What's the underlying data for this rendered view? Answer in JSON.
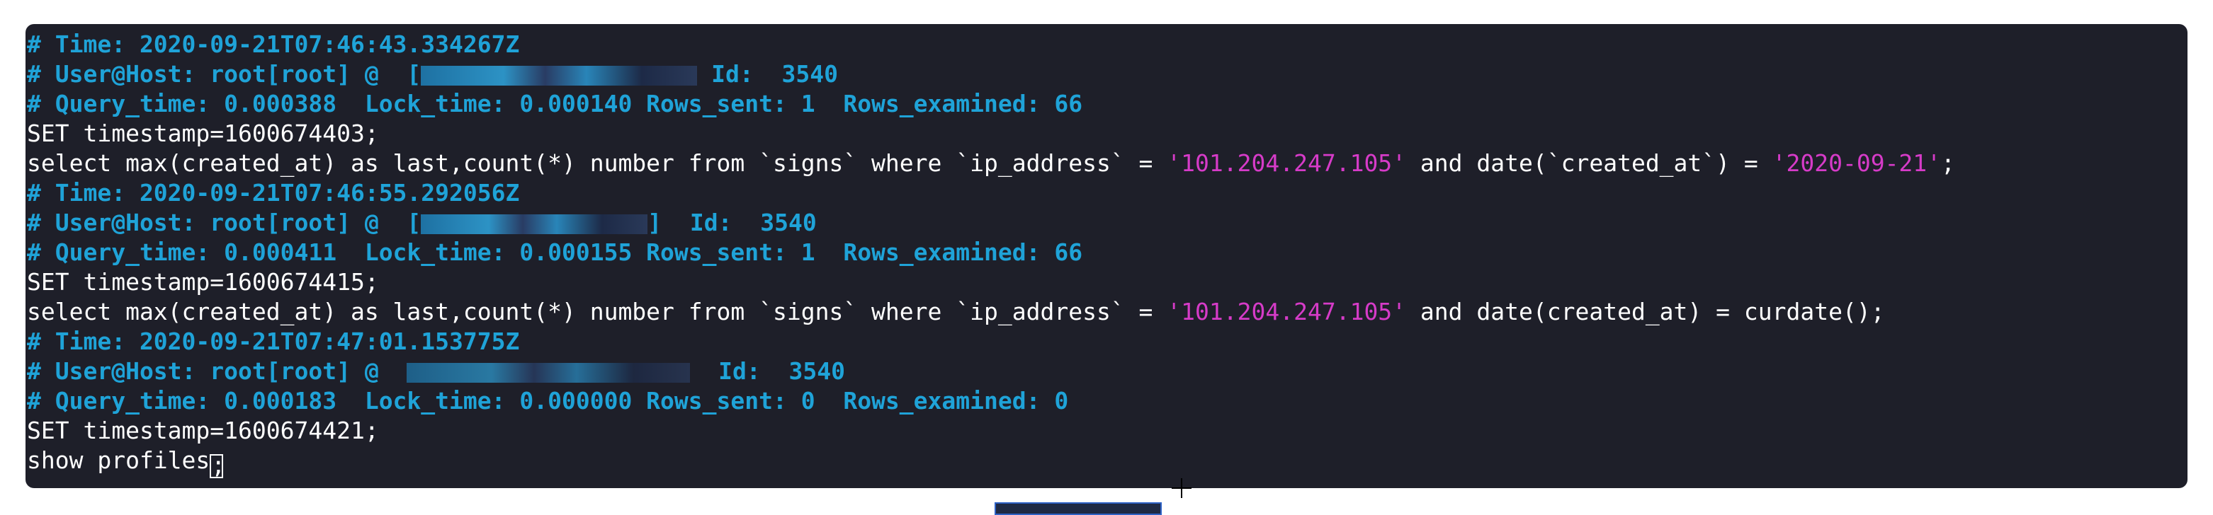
{
  "terminal": {
    "lines": [
      {
        "type": "comment",
        "text": "# Time: 2020-09-21T07:46:43.334267Z"
      },
      {
        "type": "userhost",
        "prefix": "# User@Host: root[root] @  [",
        "suffix": " Id:  3540"
      },
      {
        "type": "comment",
        "text": "# Query_time: 0.000388  Lock_time: 0.000140 Rows_sent: 1  Rows_examined: 66"
      },
      {
        "type": "plain",
        "text": "SET timestamp=1600674403;"
      },
      {
        "type": "query",
        "a": "select max(created_at) as last,count(*) number from `signs` where `ip_address` = ",
        "s1": "'101.204.247.105'",
        "b": " and date(`created_at`) = ",
        "s2": "'2020-09-21'",
        "c": ";"
      },
      {
        "type": "comment",
        "text": "# Time: 2020-09-21T07:46:55.292056Z"
      },
      {
        "type": "userhost",
        "prefix": "# User@Host: root[root] @  [",
        "suffix": "]  Id:  3540"
      },
      {
        "type": "comment",
        "text": "# Query_time: 0.000411  Lock_time: 0.000155 Rows_sent: 1  Rows_examined: 66"
      },
      {
        "type": "plain",
        "text": "SET timestamp=1600674415;"
      },
      {
        "type": "query2",
        "a": "select max(created_at) as last,count(*) number from `signs` where `ip_address` = ",
        "s1": "'101.204.247.105'",
        "b": " and date(created_at) = curdate();"
      },
      {
        "type": "comment",
        "text": "# Time: 2020-09-21T07:47:01.153775Z"
      },
      {
        "type": "userhost",
        "prefix": "# User@Host: root[root] @  ",
        "suffix": "  Id:  3540"
      },
      {
        "type": "comment",
        "text": "# Query_time: 0.000183  Lock_time: 0.000000 Rows_sent: 0  Rows_examined: 0"
      },
      {
        "type": "plain",
        "text": "SET timestamp=1600674421;"
      },
      {
        "type": "prompt",
        "text": "show profiles",
        "cursor_char": ";"
      }
    ]
  },
  "colors": {
    "background": "#1e1f29",
    "comment": "#1fa3d8",
    "string": "#d63bc8",
    "text": "#ffffff"
  }
}
